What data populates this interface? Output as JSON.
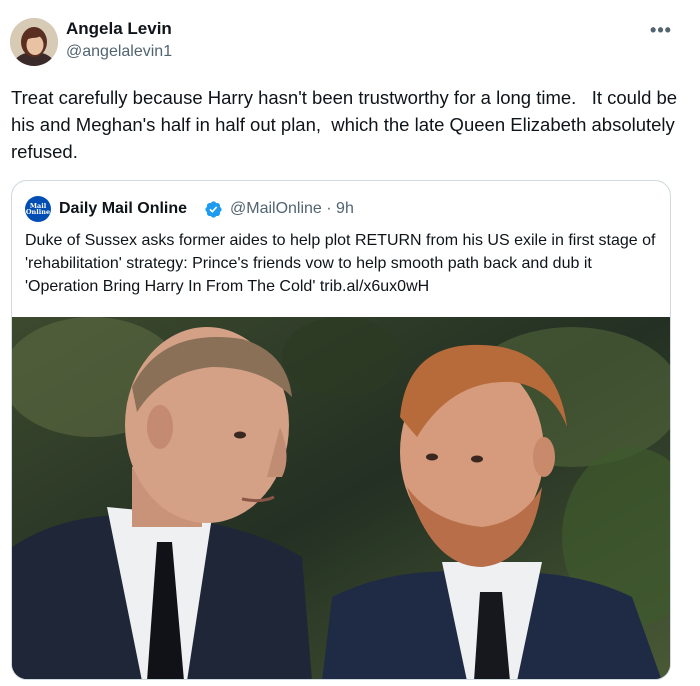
{
  "author": {
    "name": "Angela Levin",
    "handle": "@angelalevin1"
  },
  "more_icon": "more-horizontal-icon",
  "tweet": {
    "text": "Treat carefully because Harry hasn't been trustworthy for a long time.   It could be his and Meghan's half in half out plan,  which the late Queen Elizabeth absolutely refused."
  },
  "quoted_tweet": {
    "logo_line1": "Mail",
    "logo_line2": "Online",
    "author_name": "Daily Mail Online",
    "verified_icon": "verified-badge-icon",
    "handle_time": "@MailOnline · 9h",
    "text": "Duke of Sussex asks former aides to help plot RETURN from his US exile in first stage of 'rehabilitation' strategy: Prince's friends vow to help smooth path back and dub it 'Operation Bring Harry In From The Cold' trib.al/x6ux0wH",
    "image_alt": "Photo of two men in dark suits looking at each other"
  },
  "colors": {
    "text": "#0f1419",
    "secondary": "#536471",
    "border": "#cfd9de",
    "verified": "#1d9bf0",
    "mail_blue": "#004db3"
  }
}
